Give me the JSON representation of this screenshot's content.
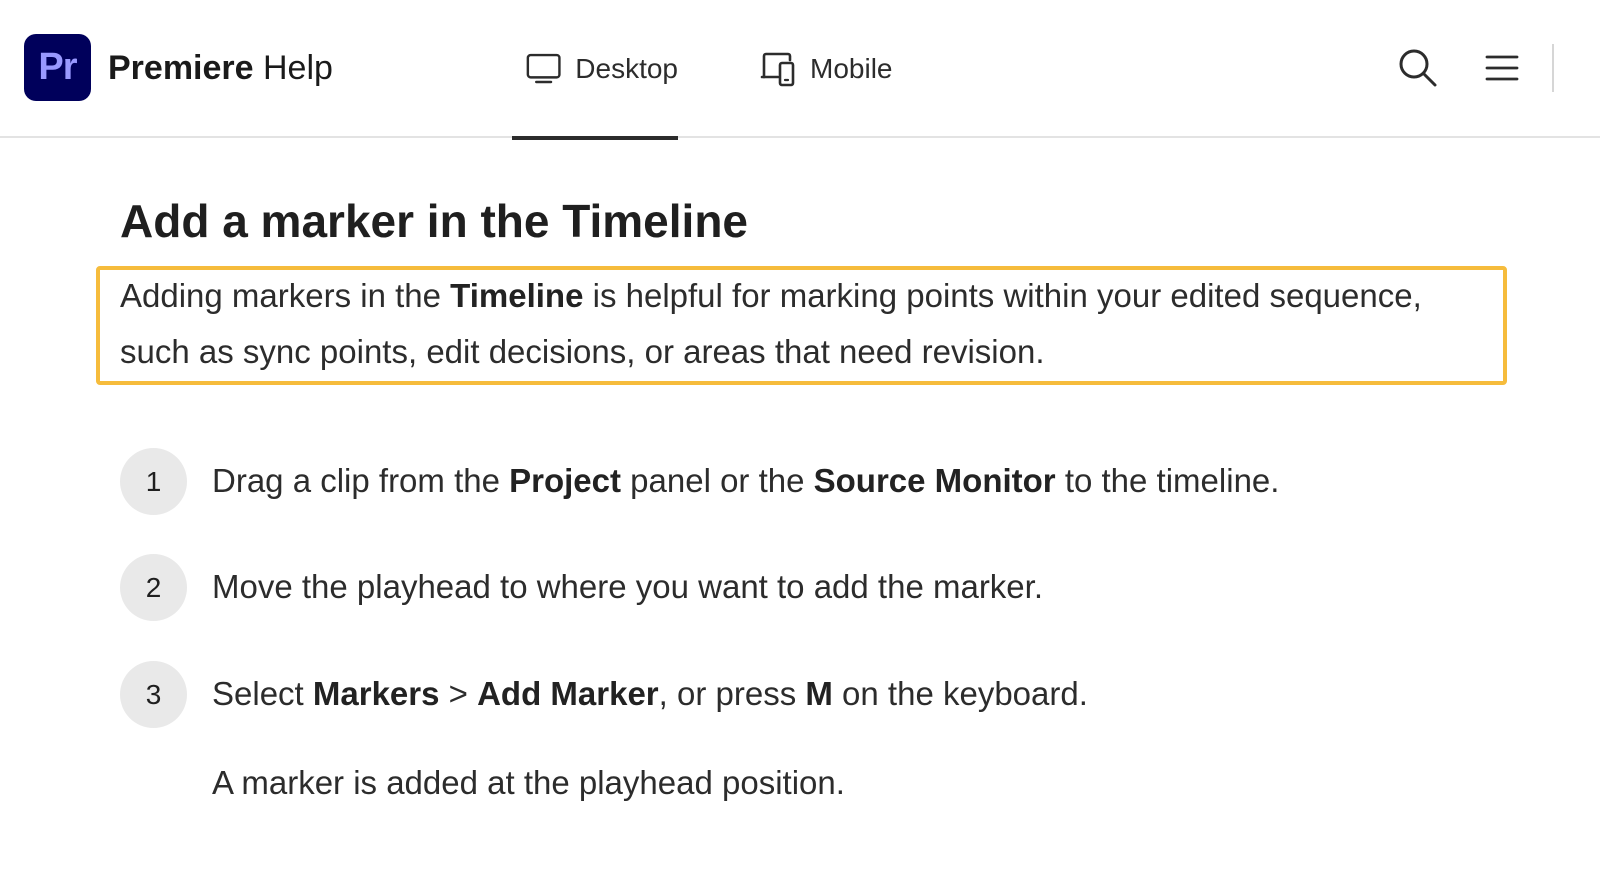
{
  "header": {
    "logo_text": "Pr",
    "brand_strong": "Premiere",
    "brand_rest": " Help",
    "tabs": [
      {
        "label": "Desktop",
        "active": true,
        "icon": "monitor-icon"
      },
      {
        "label": "Mobile",
        "active": false,
        "icon": "devices-icon"
      }
    ],
    "actions": [
      {
        "icon": "search-icon"
      },
      {
        "icon": "hamburger-menu-icon"
      }
    ]
  },
  "article": {
    "title": "Add a marker in the Timeline",
    "intro": {
      "pre": "Adding markers in the ",
      "bold": "Timeline",
      "post": " is helpful for marking points within your edited sequence, such as sync points, edit decisions, or areas that need revision."
    },
    "steps": [
      {
        "number": "1",
        "parts": [
          {
            "t": "Drag a clip from the "
          },
          {
            "t": "Project",
            "b": true
          },
          {
            "t": " panel or the "
          },
          {
            "t": "Source Monitor",
            "b": true
          },
          {
            "t": " to the timeline."
          }
        ]
      },
      {
        "number": "2",
        "parts": [
          {
            "t": "Move the playhead to where you want to add the marker."
          }
        ]
      },
      {
        "number": "3",
        "parts": [
          {
            "t": "Select "
          },
          {
            "t": "Markers",
            "b": true
          },
          {
            "t": " > "
          },
          {
            "t": "Add Marker",
            "b": true
          },
          {
            "t": ", or press "
          },
          {
            "t": "M",
            "b": true
          },
          {
            "t": " on the keyboard."
          }
        ]
      }
    ],
    "result": "A marker is added at the playhead position."
  },
  "colors": {
    "logo_bg": "#00005b",
    "logo_fg": "#9999ff",
    "highlight_border": "#f6bc3c",
    "step_circle": "#e9e9e9"
  }
}
